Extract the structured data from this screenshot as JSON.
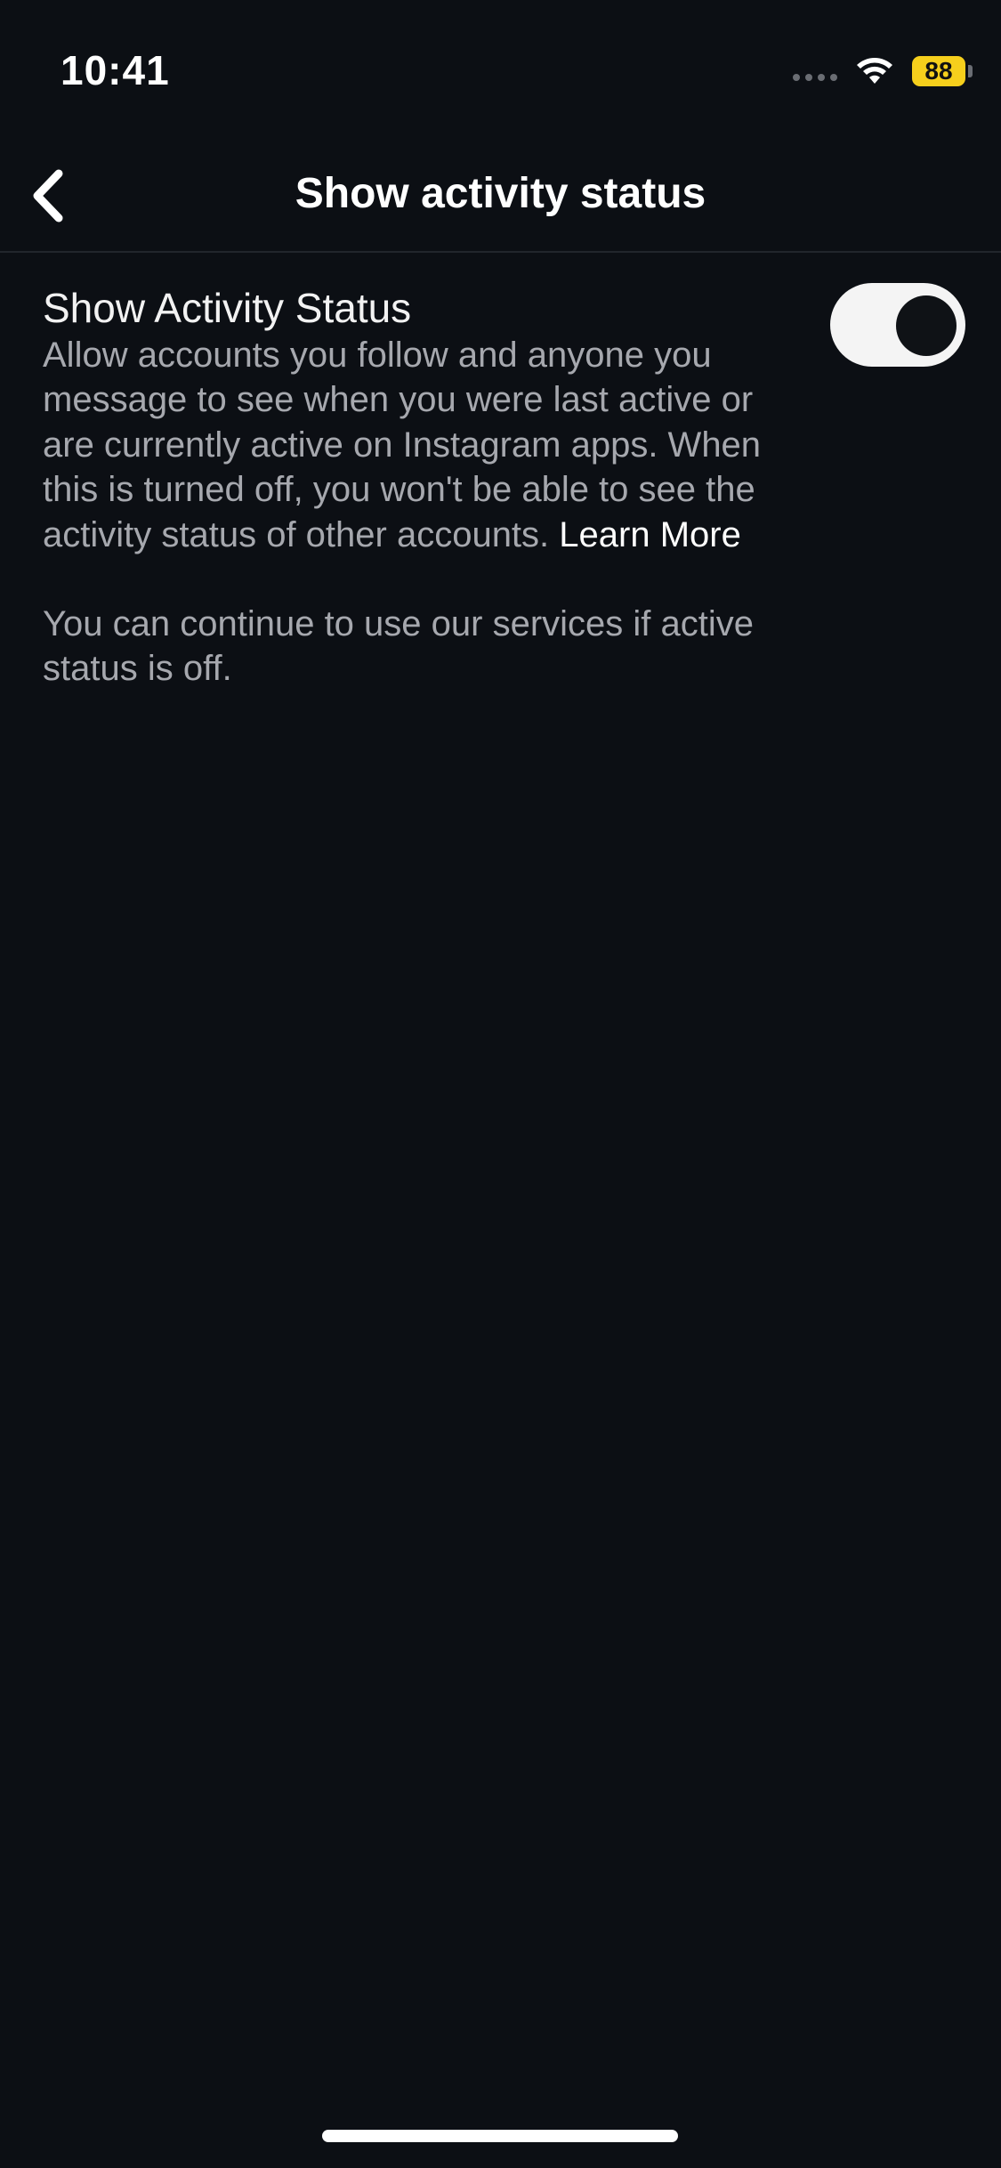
{
  "status_bar": {
    "time": "10:41",
    "battery_level": "88",
    "battery_color": "#f6cf1c"
  },
  "header": {
    "title": "Show activity status",
    "back_icon": "chevron-left-icon"
  },
  "setting": {
    "title": "Show Activity Status",
    "description": "Allow accounts you follow and anyone you message to see when you were last active or are currently active on Instagram apps. When this is turned off, you won't be able to see the activity status of other accounts.",
    "learn_more": "Learn More",
    "toggle_on": false
  },
  "note": {
    "text": "You can continue to use our services if active status is off."
  },
  "theme": {
    "background": "#0c0f14",
    "secondary_text": "#a6a8ae"
  }
}
